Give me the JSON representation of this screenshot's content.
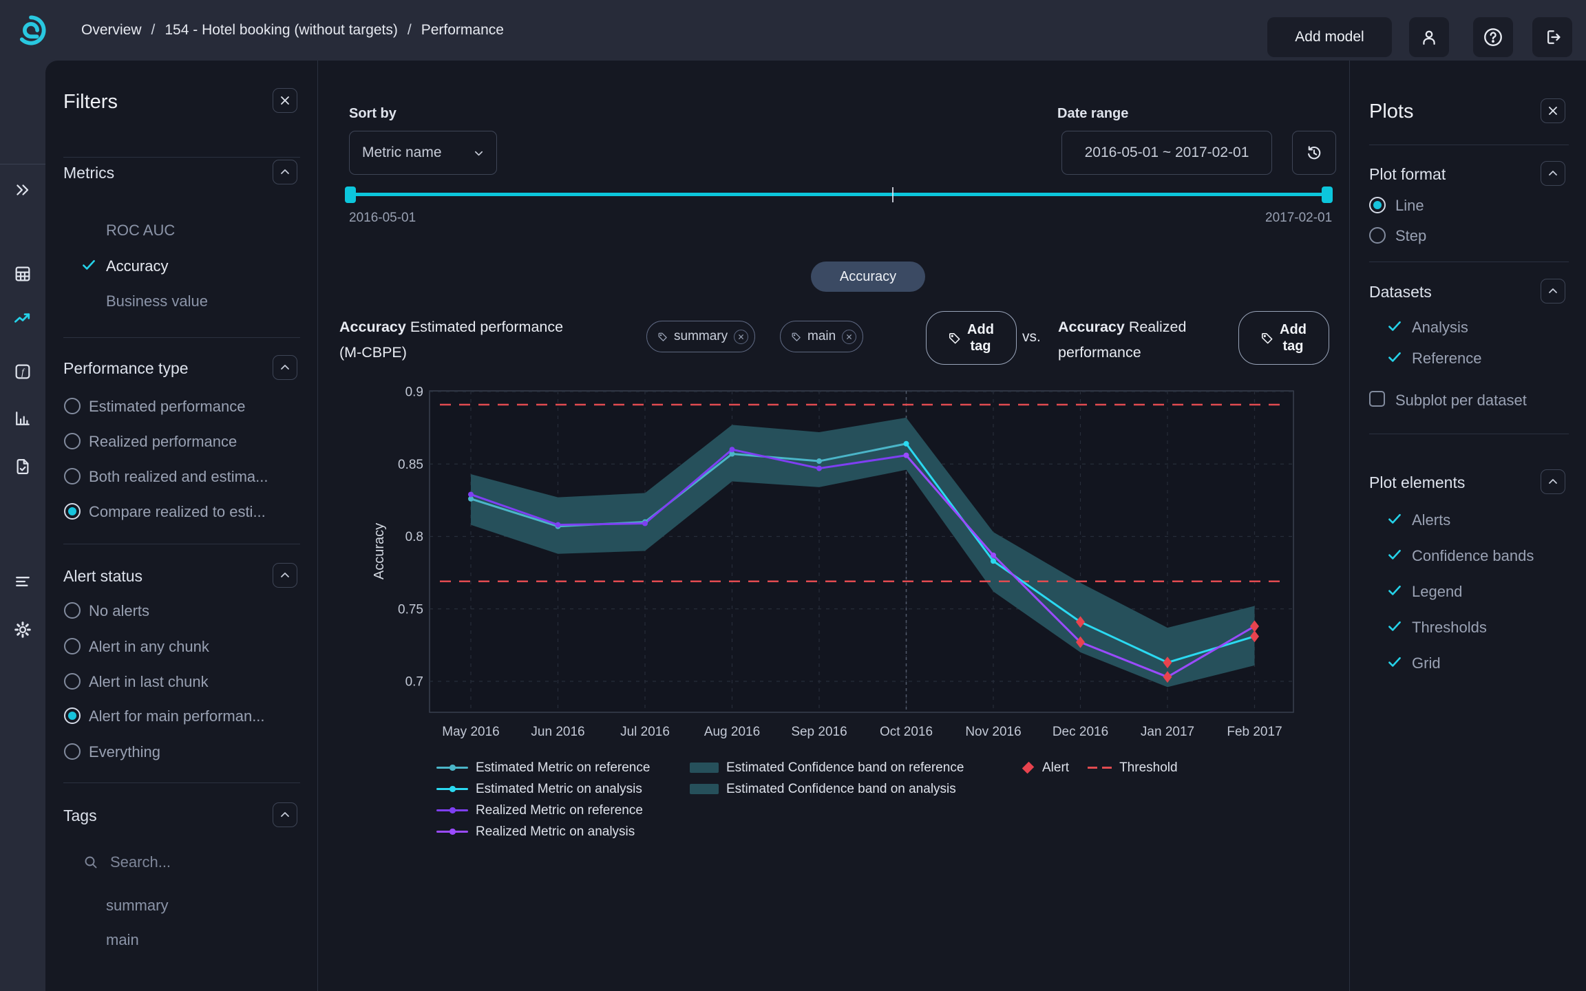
{
  "colors": {
    "accent": "#25d2e9",
    "panel_bg": "#151822",
    "topbar_bg": "#272b39"
  },
  "topbar": {
    "breadcrumb": [
      "Overview",
      "154 - Hotel booking (without targets)",
      "Performance"
    ],
    "breadcrumb_separator": "/",
    "add_model_label": "Add model"
  },
  "filters": {
    "title": "Filters",
    "metrics": {
      "title": "Metrics",
      "items": [
        {
          "label": "ROC AUC",
          "checked": false
        },
        {
          "label": "Accuracy",
          "checked": true
        },
        {
          "label": "Business value",
          "checked": false
        }
      ]
    },
    "performance_type": {
      "title": "Performance type",
      "options": [
        {
          "label": "Estimated performance",
          "selected": false
        },
        {
          "label": "Realized performance",
          "selected": false
        },
        {
          "label": "Both realized and estima...",
          "selected": false
        },
        {
          "label": "Compare realized to esti...",
          "selected": true
        }
      ]
    },
    "alert_status": {
      "title": "Alert status",
      "options": [
        {
          "label": "No alerts",
          "selected": false
        },
        {
          "label": "Alert in any chunk",
          "selected": false
        },
        {
          "label": "Alert in last chunk",
          "selected": false
        },
        {
          "label": "Alert for main performan...",
          "selected": true
        },
        {
          "label": "Everything",
          "selected": false
        }
      ]
    },
    "tags": {
      "title": "Tags",
      "search_placeholder": "Search...",
      "items": [
        "summary",
        "main"
      ]
    }
  },
  "main": {
    "sort_by": {
      "label": "Sort by",
      "value": "Metric name"
    },
    "date_range": {
      "label": "Date range",
      "value": "2016-05-01 ~ 2017-02-01",
      "start": "2016-05-01",
      "end": "2017-02-01"
    },
    "metric_pill": "Accuracy",
    "comparison": {
      "left": {
        "metric": "Accuracy",
        "title_rest": "Estimated performance",
        "title_line2": "(M-CBPE)",
        "tags": [
          "summary",
          "main"
        ]
      },
      "vs_label": "vs.",
      "right": {
        "metric": "Accuracy",
        "title_rest": "Realized",
        "title_line2": "performance"
      },
      "add_tag_label": "Add tag"
    }
  },
  "chart_data": {
    "type": "line",
    "ylabel": "Accuracy",
    "x": [
      "May 2016",
      "Jun 2016",
      "Jul 2016",
      "Aug 2016",
      "Sep 2016",
      "Oct 2016",
      "Nov 2016",
      "Dec 2016",
      "Jan 2017",
      "Feb 2017"
    ],
    "yticks": [
      0.9,
      0.85,
      0.8,
      0.75,
      0.7
    ],
    "ylim": [
      0.678,
      0.9
    ],
    "grid": true,
    "legend_position": "bottom",
    "reference_split_index": 5,
    "thresholds": {
      "upper": 0.891,
      "lower": 0.769
    },
    "series": [
      {
        "name": "Estimated Metric",
        "values": [
          0.826,
          0.807,
          0.81,
          0.857,
          0.852,
          0.864,
          0.783,
          0.741,
          0.713,
          0.731
        ]
      },
      {
        "name": "Realized Metric",
        "values": [
          0.829,
          0.808,
          0.809,
          0.86,
          0.847,
          0.856,
          0.787,
          0.727,
          0.703,
          0.738
        ]
      }
    ],
    "confidence_band": {
      "series": "Estimated Metric",
      "upper": [
        0.843,
        0.827,
        0.83,
        0.877,
        0.872,
        0.882,
        0.803,
        0.768,
        0.737,
        0.752
      ],
      "lower": [
        0.808,
        0.788,
        0.79,
        0.838,
        0.834,
        0.846,
        0.762,
        0.72,
        0.696,
        0.711
      ]
    },
    "alerts": [
      {
        "x": "Dec 2016",
        "series": "Estimated Metric",
        "value": 0.741
      },
      {
        "x": "Dec 2016",
        "series": "Realized Metric",
        "value": 0.727
      },
      {
        "x": "Jan 2017",
        "series": "Estimated Metric",
        "value": 0.713
      },
      {
        "x": "Jan 2017",
        "series": "Realized Metric",
        "value": 0.703
      },
      {
        "x": "Feb 2017",
        "series": "Estimated Metric",
        "value": 0.731
      },
      {
        "x": "Feb 2017",
        "series": "Realized Metric",
        "value": 0.738
      }
    ],
    "legend": [
      "Estimated Metric on reference",
      "Estimated Metric on analysis",
      "Realized Metric on reference",
      "Realized Metric on analysis",
      "Estimated Confidence band on reference",
      "Estimated Confidence band on analysis",
      "Alert",
      "Threshold"
    ],
    "colors": {
      "estimated_reference": "#4bb5c8",
      "estimated_analysis": "#2bd9f1",
      "realized_reference": "#7e3ff2",
      "realized_analysis": "#9a4bff",
      "confidence_band": "#26505b",
      "alert": "#e8434e",
      "threshold": "#e14b50",
      "grid": "#272d3a",
      "split_line": "#515a6b",
      "axis_text": "#c3c9d6",
      "plot_border": "#39404f",
      "plot_bg": "#12151f"
    }
  },
  "plots_panel": {
    "title": "Plots",
    "plot_format": {
      "title": "Plot format",
      "options": [
        {
          "label": "Line",
          "selected": true
        },
        {
          "label": "Step",
          "selected": false
        }
      ]
    },
    "datasets": {
      "title": "Datasets",
      "items": [
        {
          "label": "Analysis",
          "checked": true
        },
        {
          "label": "Reference",
          "checked": true
        }
      ],
      "subplot_label": "Subplot per dataset",
      "subplot_checked": false
    },
    "plot_elements": {
      "title": "Plot elements",
      "items": [
        {
          "label": "Alerts",
          "checked": true
        },
        {
          "label": "Confidence bands",
          "checked": true
        },
        {
          "label": "Legend",
          "checked": true
        },
        {
          "label": "Thresholds",
          "checked": true
        },
        {
          "label": "Grid",
          "checked": true
        }
      ]
    }
  }
}
